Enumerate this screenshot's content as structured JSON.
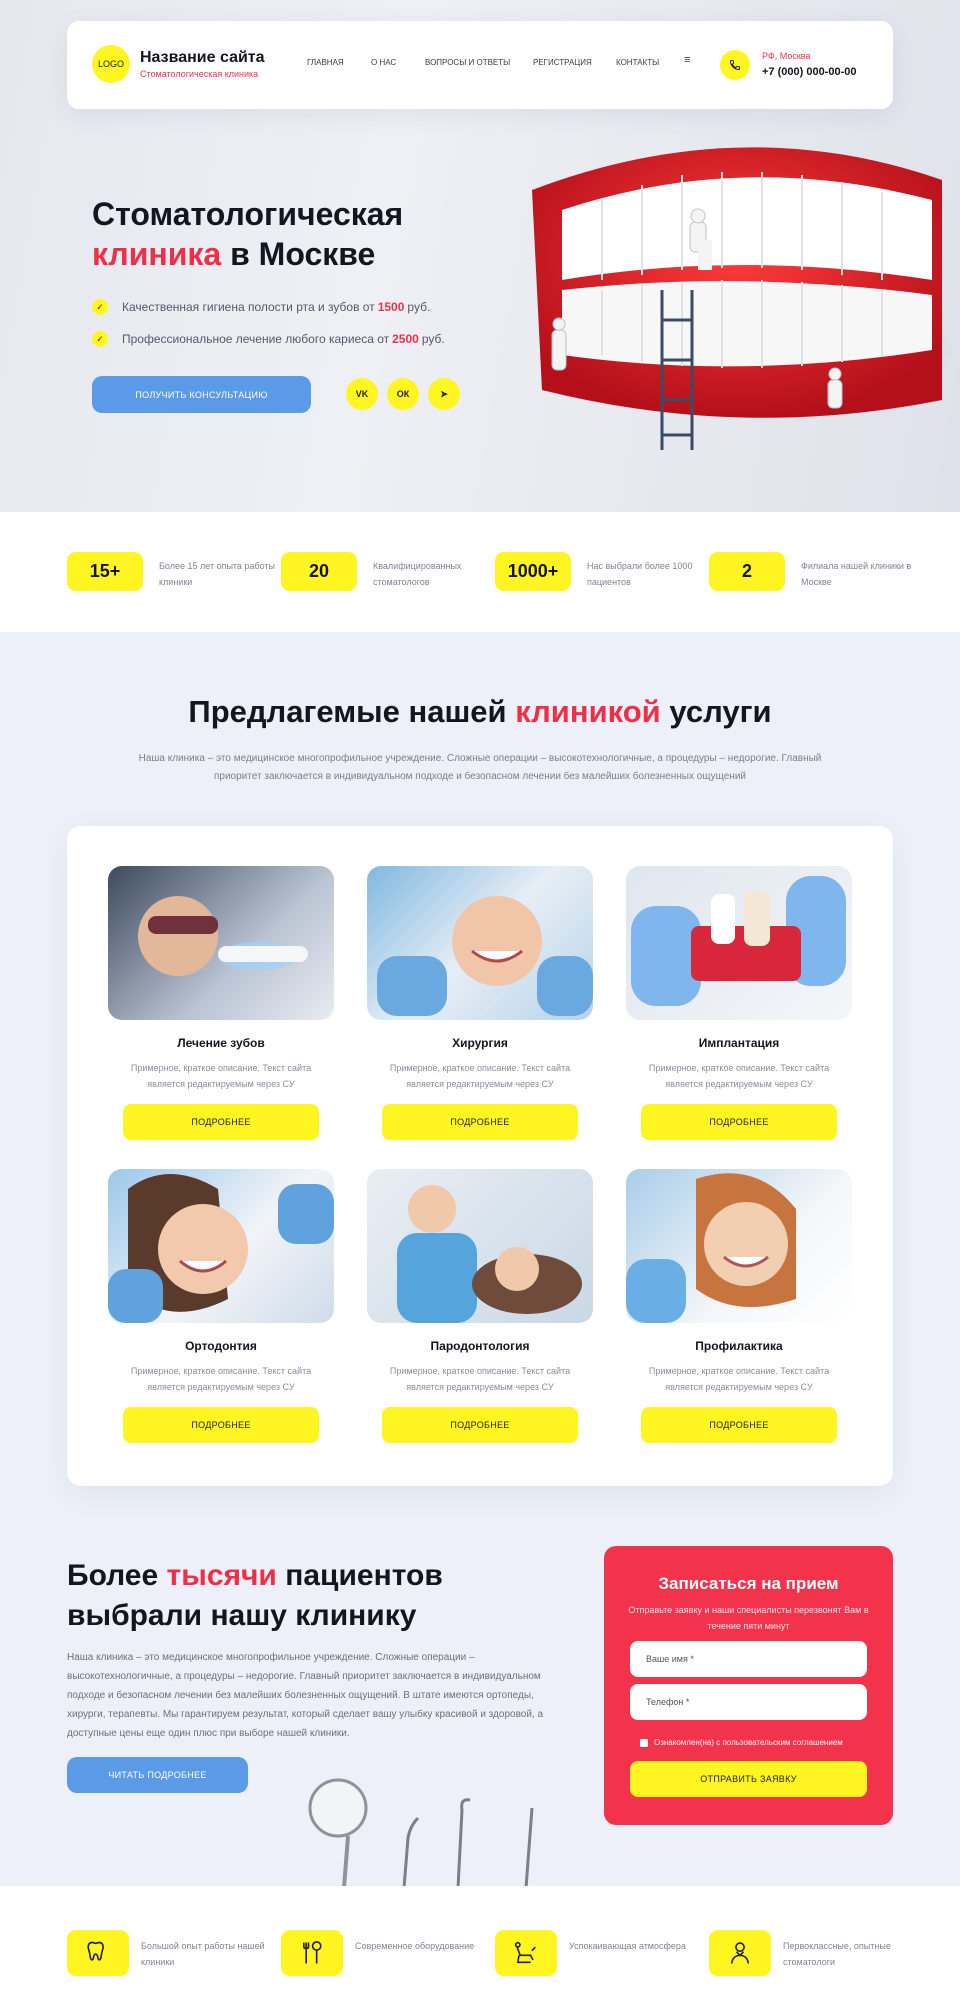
{
  "header": {
    "logo": "LOGO",
    "site_name": "Название сайта",
    "site_sub": "Стоматологическая клиника",
    "nav": [
      "ГЛАВНАЯ",
      "О НАС",
      "ВОПРОСЫ И ОТВЕТЫ",
      "РЕГИСТРАЦИЯ",
      "КОНТАКТЫ"
    ],
    "menu_icon": "≡",
    "city": "РФ, Москва",
    "phone": "+7 (000) 000-00-00"
  },
  "hero": {
    "title_line1": "Стоматологическая",
    "title_red": "клиника",
    "title_rest": "в Москве",
    "bullet1_text": "Качественная гигиена полости рта и зубов от",
    "bullet1_price": "1500",
    "bullet1_unit": "руб.",
    "bullet2_text": "Профессиональное лечение любого кариеса от",
    "bullet2_price": "2500",
    "bullet2_unit": "руб.",
    "cta": "ПОЛУЧИТЬ КОНСУЛЬТАЦИЮ",
    "socials": [
      "vk-icon",
      "ok-icon",
      "telegram-icon"
    ],
    "social_labels": [
      "VK",
      "ОК",
      "➤"
    ]
  },
  "stats": [
    {
      "num": "15+",
      "text": "Более 15 лет опыта работы клиники"
    },
    {
      "num": "20",
      "text": "Квалифицированных стоматологов"
    },
    {
      "num": "1000+",
      "text": "Нас выбрали более 1000 пациентов"
    },
    {
      "num": "2",
      "text": "Филиала нашей клиники в Москве"
    }
  ],
  "services": {
    "title_pre": "Предлагемые нашей",
    "title_red": "клиникой",
    "title_post": "услуги",
    "desc": "Наша клиника – это медицинское многопрофильное учреждение. Сложные операции – высокотехнологичные, а процедуры – недорогие. Главный приоритет заключается в индивидуальном подходе и безопасном лечении без малейших болезненных ощущений",
    "items": [
      {
        "name": "Лечение зубов",
        "text": "Примерное, краткое описание. Текст сайта является редактируемым через CУ",
        "button": "ПОДРОБНЕЕ"
      },
      {
        "name": "Хирургия",
        "text": "Примерное, краткое описание. Текст сайта является редактируемым через CУ",
        "button": "ПОДРОБНЕЕ"
      },
      {
        "name": "Имплантация",
        "text": "Примерное, краткое описание. Текст сайта является редактируемым через CУ",
        "button": "ПОДРОБНЕЕ"
      },
      {
        "name": "Ортодонтия",
        "text": "Примерное, краткое описание. Текст сайта является редактируемым через CУ",
        "button": "ПОДРОБНЕЕ"
      },
      {
        "name": "Пародонтология",
        "text": "Примерное, краткое описание. Текст сайта является редактируемым через CУ",
        "button": "ПОДРОБНЕЕ"
      },
      {
        "name": "Профилактика",
        "text": "Примерное, краткое описание. Текст сайта является редактируемым через CУ",
        "button": "ПОДРОБНЕЕ"
      }
    ]
  },
  "about": {
    "title_pre": "Более",
    "title_red": "тысячи",
    "title_post": "пациентов выбрали нашу клинику",
    "text": "Наша клиника – это медицинское многопрофильное учреждение. Сложные операции – высокотехнологичные, а процедуры – недорогие. Главный приоритет заключается в индивидуальном подходе и безопасном лечении без малейших болезненных ощущений. В штате имеются ортопеды, хирурги, терапевты. Мы гарантируем результат, который сделает вашу улыбку красивой и здоровой, а доступные цены еще один плюс при выборе нашей клиники.",
    "button": "ЧИТАТЬ ПОДРОБНЕЕ"
  },
  "form": {
    "title": "Записаться на прием",
    "sub": "Отправьте заявку и наши специалисты перезвонят Вам в течение пяти минут",
    "name_placeholder": "Ваше имя *",
    "phone_placeholder": "Телефон *",
    "agree": "Ознакомлен(на) с пользовательским соглашением",
    "button": "ОТПРАВИТЬ ЗАЯВКУ"
  },
  "features": [
    {
      "icon": "tooth-icon",
      "text": "Большой опыт работы нашей клиники"
    },
    {
      "icon": "dental-tools-icon",
      "text": "Современное оборудование"
    },
    {
      "icon": "dental-chair-icon",
      "text": "Успокаивающая атмосфера"
    },
    {
      "icon": "dentist-icon",
      "text": "Первоклассные, опытные стоматологи"
    }
  ],
  "colors": {
    "accent_yellow": "#fff521",
    "accent_red": "#ef2f47",
    "accent_blue": "#5a9ae6"
  }
}
